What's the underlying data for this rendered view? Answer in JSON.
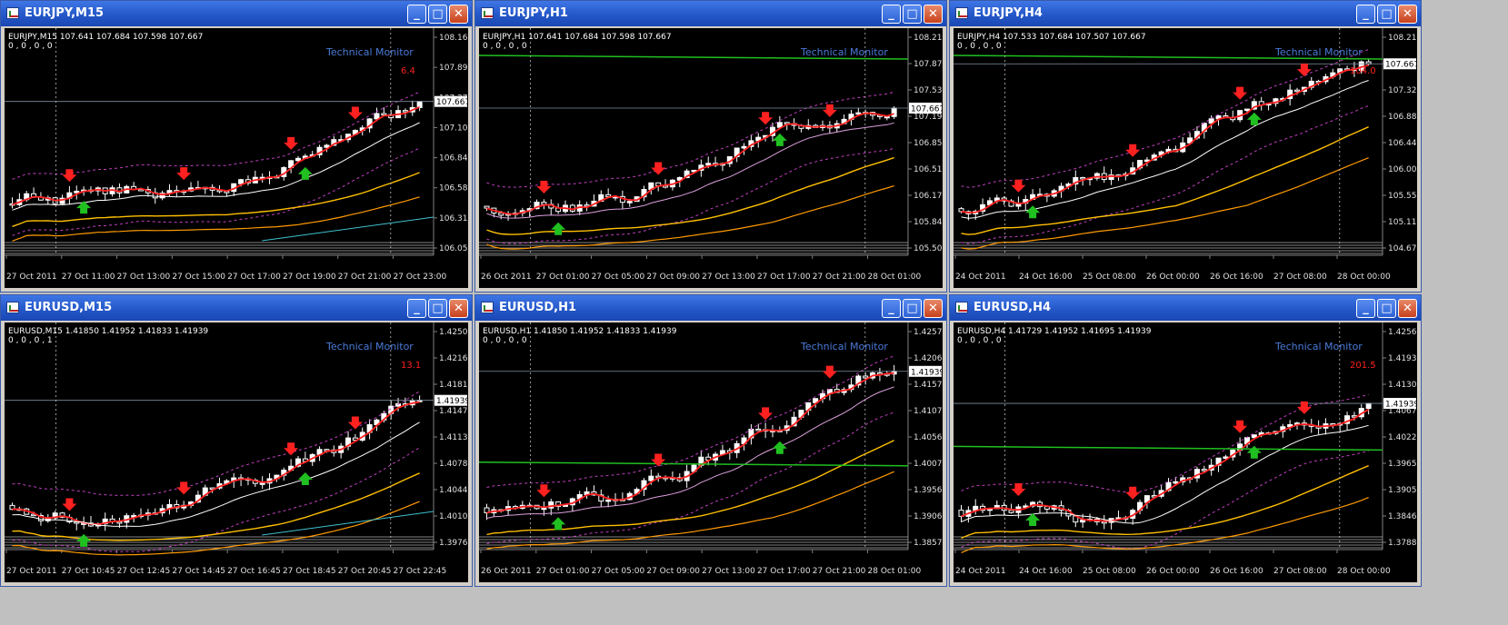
{
  "windows": [
    {
      "title": "EURJPY,M15",
      "header_line1": "EURJPY,M15  107.641 107.684 107.598 107.667",
      "header_line2": "0 , 0 , 0 , 0",
      "monitor_label": "Technical  Monitor",
      "signal_value": "6.4",
      "price_tag": "107.667",
      "price_axis": [
        "108.160",
        "107.895",
        "107.370",
        "107.105",
        "106.840",
        "106.580",
        "106.315",
        "106.050"
      ],
      "time_axis": [
        "27 Oct 2011",
        "27 Oct 11:00",
        "27 Oct 13:00",
        "27 Oct 15:00",
        "27 Oct 17:00",
        "27 Oct 19:00",
        "27 Oct 21:00",
        "27 Oct 23:00"
      ]
    },
    {
      "title": "EURJPY,H1",
      "header_line1": "EURJPY,H1  107.641 107.684 107.598 107.667",
      "header_line2": "0 , 0 , 0 , 0",
      "monitor_label": "Technical  Monitor",
      "signal_value": "",
      "price_tag": "107.667",
      "price_axis": [
        "108.210",
        "107.870",
        "107.530",
        "107.190",
        "106.850",
        "106.510",
        "106.170",
        "105.840",
        "105.500"
      ],
      "time_axis": [
        "26 Oct 2011",
        "27 Oct 01:00",
        "27 Oct 05:00",
        "27 Oct 09:00",
        "27 Oct 13:00",
        "27 Oct 17:00",
        "27 Oct 21:00",
        "28 Oct 01:00"
      ]
    },
    {
      "title": "EURJPY,H4",
      "header_line1": "EURJPY,H4  107.533 107.684 107.507 107.667",
      "header_line2": "0 , 0 , 0 , 0",
      "monitor_label": "Technical  Monitor",
      "signal_value": "104.0",
      "price_tag": "107.667",
      "price_axis": [
        "108.210",
        "107.770",
        "107.320",
        "106.880",
        "106.440",
        "106.000",
        "105.550",
        "105.110",
        "104.670"
      ],
      "time_axis": [
        "24 Oct 2011",
        "24 Oct 16:00",
        "25 Oct 08:00",
        "26 Oct 00:00",
        "26 Oct 16:00",
        "27 Oct 08:00",
        "28 Oct 00:00"
      ]
    },
    {
      "title": "EURUSD,M15",
      "header_line1": "EURUSD,M15  1.41850 1.41952 1.41833 1.41939",
      "header_line2": "0 , 0 , 0 , 1",
      "monitor_label": "Technical  Monitor",
      "signal_value": "13.1",
      "price_tag": "1.41939",
      "price_axis": [
        "1.42500",
        "1.42160",
        "1.41810",
        "1.41470",
        "1.41130",
        "1.40780",
        "1.40440",
        "1.40100",
        "1.39760"
      ],
      "time_axis": [
        "27 Oct 2011",
        "27 Oct 10:45",
        "27 Oct 12:45",
        "27 Oct 14:45",
        "27 Oct 16:45",
        "27 Oct 18:45",
        "27 Oct 20:45",
        "27 Oct 22:45"
      ]
    },
    {
      "title": "EURUSD,H1",
      "header_line1": "EURUSD,H1  1.41850 1.41952 1.41833 1.41939",
      "header_line2": "0 , 0 , 0 , 0",
      "monitor_label": "Technical  Monitor",
      "signal_value": "",
      "price_tag": "1.41939",
      "price_axis": [
        "1.42575",
        "1.42065",
        "1.41570",
        "1.41075",
        "1.40565",
        "1.40070",
        "1.39560",
        "1.39065",
        "1.38570"
      ],
      "time_axis": [
        "26 Oct 2011",
        "27 Oct 01:00",
        "27 Oct 05:00",
        "27 Oct 09:00",
        "27 Oct 13:00",
        "27 Oct 17:00",
        "27 Oct 21:00",
        "28 Oct 01:00"
      ]
    },
    {
      "title": "EURUSD,H4",
      "header_line1": "EURUSD,H4  1.41729 1.41952 1.41695 1.41939",
      "header_line2": "0 , 0 , 0 , 0",
      "monitor_label": "Technical  Monitor",
      "signal_value": "201.5",
      "price_tag": "1.41939",
      "price_axis": [
        "1.42560",
        "1.41930",
        "1.41300",
        "1.40670",
        "1.40220",
        "1.39650",
        "1.39050",
        "1.38465",
        "1.37880"
      ],
      "time_axis": [
        "24 Oct 2011",
        "24 Oct 16:00",
        "25 Oct 08:00",
        "26 Oct 00:00",
        "26 Oct 16:00",
        "27 Oct 08:00",
        "28 Oct 00:00"
      ]
    }
  ],
  "colors": {
    "background": "#000000",
    "bull_candle": "#ffffff",
    "ma_fast": "#ff2020",
    "ma_slow": "#ffffff",
    "ma_lilac": "#dda0dd",
    "ma_gold": "#ffc000",
    "ma_orange": "#ff9a00",
    "ma_cyan": "#40c0d0",
    "bands": "#c040c0",
    "level_green": "#20c020",
    "sell_arrow": "#ff2020",
    "buy_arrow": "#20c020",
    "monitor_text": "#4a7ad8",
    "titlebar": "#2457c8"
  },
  "window_buttons": {
    "minimize": "_",
    "maximize": "□",
    "close": "✕"
  }
}
